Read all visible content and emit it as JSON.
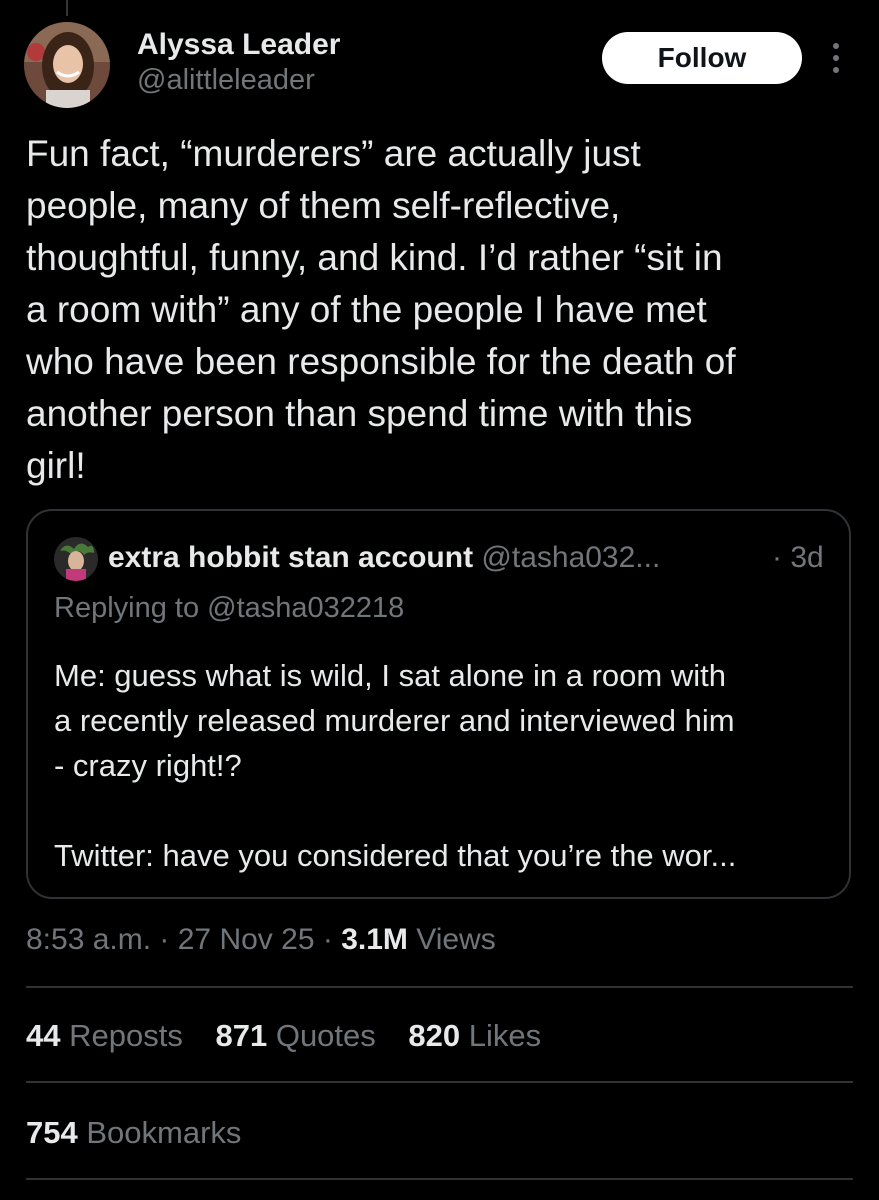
{
  "author": {
    "display_name": "Alyssa Leader",
    "handle": "@alittleleader",
    "avatar_icon": "profile-photo"
  },
  "follow_label": "Follow",
  "more_icon": "more-vertical-icon",
  "tweet": {
    "text": "Fun fact, “murderers” are actually just\npeople, many of them self-reflective,\nthoughtful, funny, and kind. I’d rather “sit in\na room with” any of the people I have met\nwho have been responsible for the death of\nanother person than spend time with this\ngirl!"
  },
  "quoted": {
    "display_name": "extra hobbit stan account",
    "handle": "@tasha032...",
    "time": "· 3d",
    "replying_to": "Replying to @tasha032218",
    "text": "Me: guess what is wild, I sat alone in a room with\na recently released murderer and interviewed him\n- crazy right!?\n\nTwitter: have you considered that you’re the wor..."
  },
  "meta": {
    "time": "8:53 a.m.",
    "sep1": " · ",
    "date": "27 Nov 25",
    "sep2": " · ",
    "views_count": "3.1M",
    "views_label": " Views"
  },
  "stats": {
    "reposts_count": "44",
    "reposts_label": "Reposts",
    "quotes_count": "871",
    "quotes_label": "Quotes",
    "likes_count": "820",
    "likes_label": "Likes",
    "bookmarks_count": "754",
    "bookmarks_label": "Bookmarks"
  },
  "colors": {
    "background": "#000000",
    "text_primary": "#e7e9ea",
    "text_secondary": "#71767b",
    "border": "#2f3336",
    "follow_bg": "#ffffff"
  }
}
